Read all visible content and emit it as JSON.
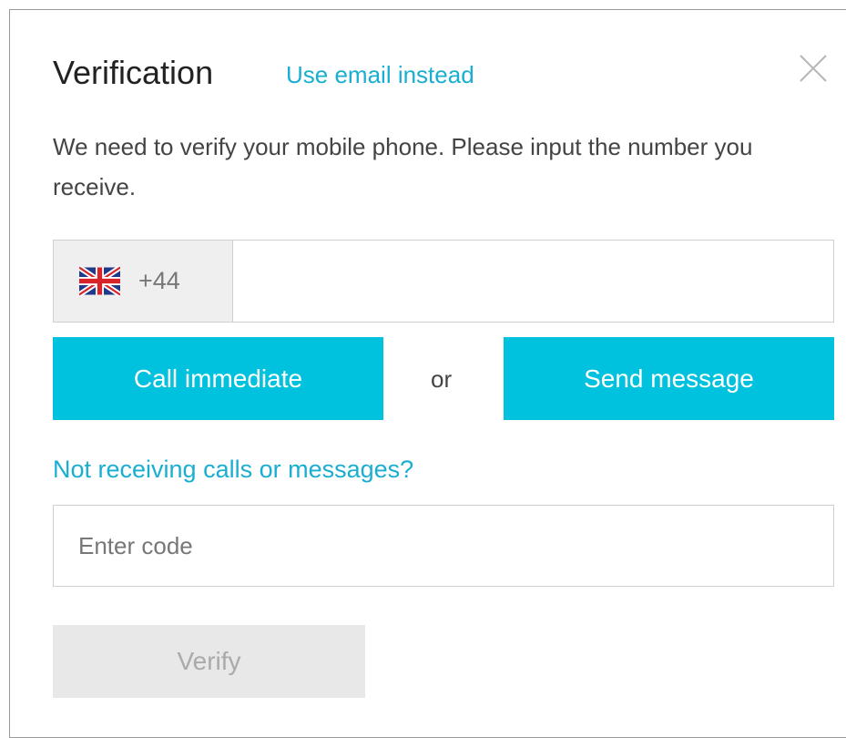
{
  "dialog": {
    "title": "Verification",
    "alt_link": "Use email instead",
    "instructions": "We need to verify your mobile phone. Please input the number you receive.",
    "country": {
      "flag": "uk-flag-icon",
      "dial_code": "+44"
    },
    "phone_input": {
      "value": "",
      "placeholder": ""
    },
    "call_button": "Call immediate",
    "separator": "or",
    "send_button": "Send message",
    "help_link": "Not receiving calls or messages?",
    "code_input": {
      "value": "",
      "placeholder": "Enter code"
    },
    "verify_button": "Verify"
  },
  "colors": {
    "accent": "#00c1de",
    "link": "#1aaed1",
    "disabled_bg": "#e8e8e8",
    "disabled_text": "#aaaaaa"
  }
}
